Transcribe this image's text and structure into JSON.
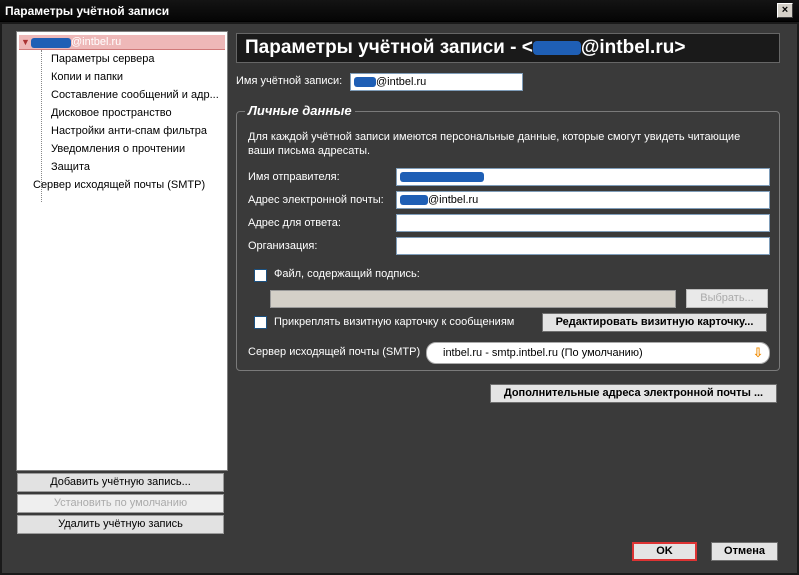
{
  "window": {
    "title": "Параметры учётной записи"
  },
  "tree": {
    "root_suffix": "@intbel.ru",
    "items": [
      "Параметры сервера",
      "Копии и папки",
      "Составление сообщений и адр...",
      "Дисковое пространство",
      "Настройки анти-спам фильтра",
      "Уведомления о прочтении",
      "Защита"
    ],
    "smtp_item": "Сервер исходящей почты (SMTP)"
  },
  "left_buttons": {
    "add": "Добавить учётную запись...",
    "set_default": "Установить по умолчанию",
    "delete": "Удалить учётную запись"
  },
  "header": {
    "prefix": "Параметры учётной записи - <",
    "suffix": "@intbel.ru>"
  },
  "account_name": {
    "label": "Имя учётной записи:",
    "value_suffix": "@intbel.ru"
  },
  "personal": {
    "title": "Личные данные",
    "description": "Для каждой учётной записи имеются персональные данные, которые смогут увидеть читающие ваши письма адресаты.",
    "sender_label": "Имя отправителя:",
    "email_label": "Адрес электронной почты:",
    "email_suffix": "@intbel.ru",
    "reply_label": "Адрес для ответа:",
    "reply_value": "",
    "org_label": "Организация:",
    "org_value": "",
    "signature_label": "Файл, содержащий подпись:",
    "browse_button": "Выбрать...",
    "vcard_label": "Прикреплять визитную карточку к сообщениям",
    "vcard_button": "Редактировать визитную карточку...",
    "smtp_label": "Сервер исходящей почты (SMTP)",
    "smtp_value": "intbel.ru - smtp.intbel.ru (По умолчанию)"
  },
  "extra_addresses_button": "Дополнительные адреса электронной почты ...",
  "dialog": {
    "ok": "OK",
    "cancel": "Отмена"
  },
  "colors": {
    "background": "#3a3a3a",
    "redaction": "#1f5fb5",
    "ok_border": "#d33333"
  }
}
